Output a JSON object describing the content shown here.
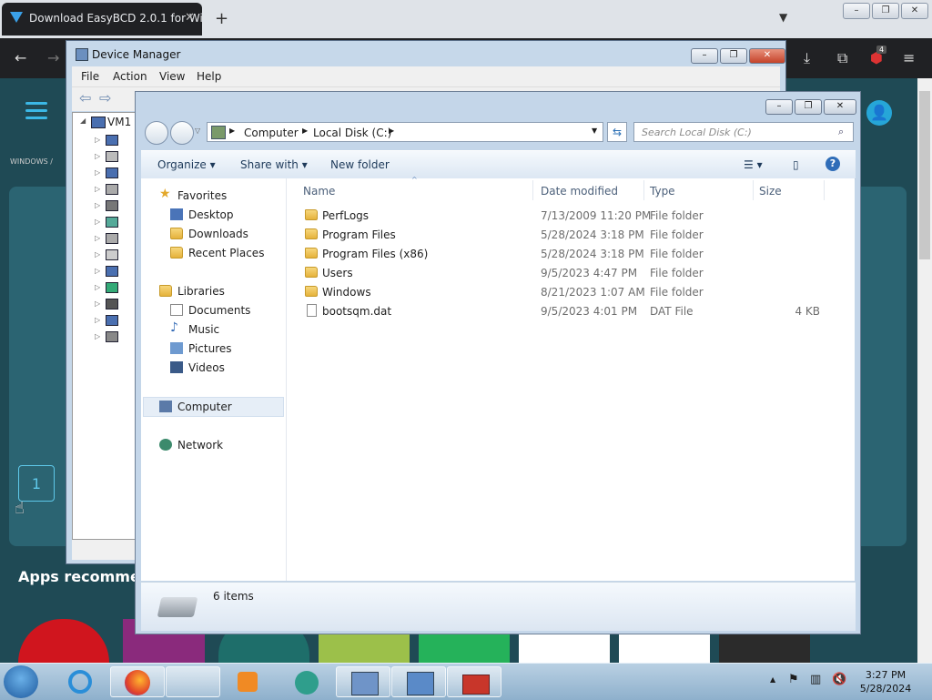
{
  "browser": {
    "tab_title": "Download EasyBCD 2.0.1 for Wi",
    "tab_close": "✕",
    "new_tab": "+",
    "tab_menu": "▼",
    "window_min": "–",
    "window_max": "❐",
    "window_close": "✕",
    "extension_badge": "4"
  },
  "page": {
    "breadcrumb": "WINDOWS  /",
    "page_number": "1",
    "apps_heading": "Apps recommended"
  },
  "device_manager": {
    "title": "Device Manager",
    "menu": [
      "File",
      "Action",
      "View",
      "Help"
    ],
    "tree_root": "VM1"
  },
  "explorer": {
    "address": [
      "Computer",
      "Local Disk (C:)"
    ],
    "search_placeholder": "Search Local Disk (C:)",
    "toolbar": {
      "organize": "Organize ▾",
      "share": "Share with ▾",
      "new_folder": "New folder"
    },
    "nav": {
      "favorites": "Favorites",
      "desktop": "Desktop",
      "downloads": "Downloads",
      "recent": "Recent Places",
      "libraries": "Libraries",
      "documents": "Documents",
      "music": "Music",
      "pictures": "Pictures",
      "videos": "Videos",
      "computer": "Computer",
      "network": "Network"
    },
    "columns": {
      "name": "Name",
      "date": "Date modified",
      "type": "Type",
      "size": "Size"
    },
    "files": [
      {
        "name": "PerfLogs",
        "date": "7/13/2009 11:20 PM",
        "type": "File folder",
        "size": "",
        "kind": "folder"
      },
      {
        "name": "Program Files",
        "date": "5/28/2024 3:18 PM",
        "type": "File folder",
        "size": "",
        "kind": "folder"
      },
      {
        "name": "Program Files (x86)",
        "date": "5/28/2024 3:18 PM",
        "type": "File folder",
        "size": "",
        "kind": "folder"
      },
      {
        "name": "Users",
        "date": "9/5/2023 4:47 PM",
        "type": "File folder",
        "size": "",
        "kind": "folder"
      },
      {
        "name": "Windows",
        "date": "8/21/2023 1:07 AM",
        "type": "File folder",
        "size": "",
        "kind": "folder"
      },
      {
        "name": "bootsqm.dat",
        "date": "9/5/2023 4:01 PM",
        "type": "DAT File",
        "size": "4 KB",
        "kind": "file"
      }
    ],
    "status": "6 items"
  },
  "taskbar": {
    "time": "3:27 PM",
    "date": "5/28/2024"
  }
}
